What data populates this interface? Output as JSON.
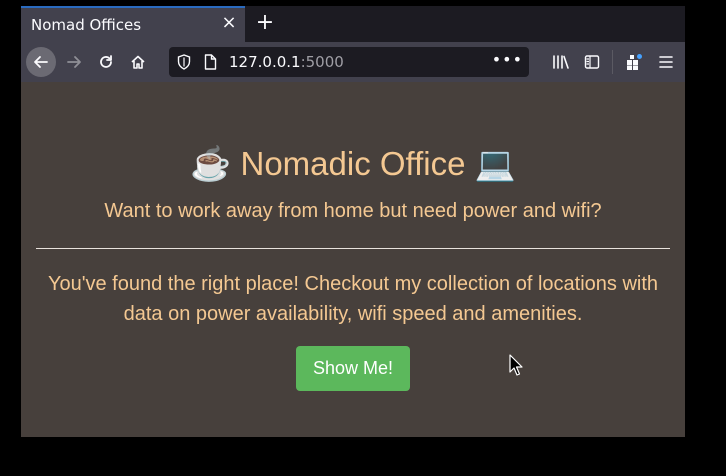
{
  "browser": {
    "tab": {
      "title": "Nomad Offices",
      "close_glyph": "×"
    },
    "new_tab_glyph": "+",
    "url": {
      "host": "127.0.0.1",
      "port": ":5000",
      "menu_glyph": "•••"
    },
    "icons": {
      "back": "back-arrow-icon",
      "forward": "forward-arrow-icon",
      "reload": "reload-icon",
      "home": "home-icon",
      "shield": "shield-icon",
      "page": "page-icon",
      "library": "library-icon",
      "sidebar": "sidebar-icon",
      "extensions": "extensions-icon",
      "menu": "hamburger-menu-icon"
    }
  },
  "page": {
    "title_left_emoji": "☕",
    "title": "Nomadic Office",
    "title_right_emoji": "💻",
    "subtitle": "Want to work away from home but need power and wifi?",
    "paragraph": "You've found the right place! Checkout my collection of locations with data on power availability, wifi speed and amenities.",
    "button_label": "Show Me!"
  },
  "colors": {
    "page_bg": "#47403c",
    "text_accent": "#f4c892",
    "button_bg": "#5cb85c",
    "browser_chrome": "#42414d"
  }
}
